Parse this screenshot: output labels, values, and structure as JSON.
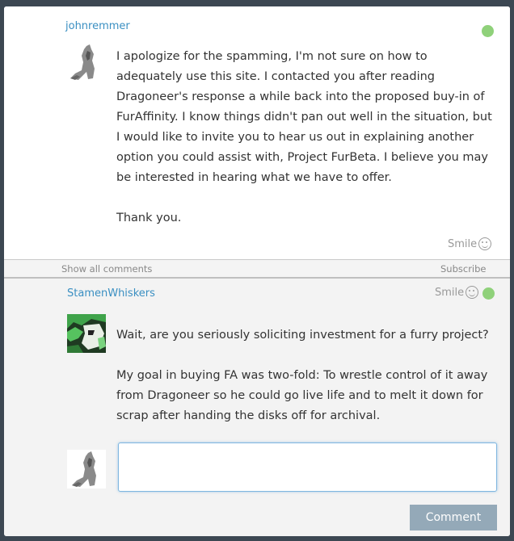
{
  "post": {
    "author": "johnremmer",
    "message": "I apologize for the spamming, I'm not sure on how to adequately use this site. I contacted you after reading Dragoneer's response a while back into the proposed buy-in of FurAffinity. I know things didn't pan out well in the situation, but I would like to invite you to hear us out in explaining another option you could assist with, Project FurBeta. I believe you may be interested in hearing what we have to offer.\n\nThank you.",
    "reaction_label": "Smile"
  },
  "comments_bar": {
    "show_all": "Show all comments",
    "subscribe": "Subscribe"
  },
  "reply": {
    "author": "StamenWhiskers",
    "reaction_label": "Smile",
    "message": "Wait, are you seriously soliciting investment for a furry project?\n\nMy goal in buying FA was two-fold: To wrestle control of it away from Dragoneer so he could go live life and to melt it down for scrap after handing the disks off for archival."
  },
  "composer": {
    "placeholder": "",
    "submit_label": "Comment"
  },
  "colors": {
    "online": "#8fd17a",
    "author_link": "#3a8fc2",
    "button": "#94a9b8"
  }
}
